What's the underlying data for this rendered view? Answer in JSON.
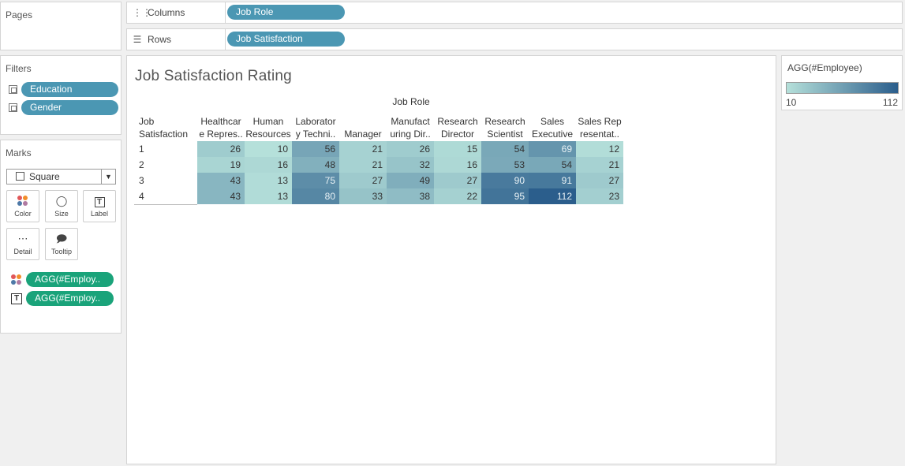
{
  "pages": {
    "title": "Pages"
  },
  "shelves": {
    "columns": {
      "label": "Columns",
      "pill": "Job Role"
    },
    "rows": {
      "label": "Rows",
      "pill": "Job Satisfaction"
    }
  },
  "filters": {
    "title": "Filters",
    "items": [
      "Education",
      "Gender"
    ]
  },
  "marks": {
    "title": "Marks",
    "type": "Square",
    "buttons": [
      "Color",
      "Size",
      "Label",
      "Detail",
      "Tooltip"
    ],
    "fields": [
      "AGG(#Employ..",
      "AGG(#Employ.."
    ]
  },
  "viz": {
    "title": "Job Satisfaction Rating",
    "column_header": "Job Role",
    "row_header": [
      "Job",
      "Satisfaction"
    ]
  },
  "legend": {
    "title": "AGG(#Employee)",
    "min": "10",
    "max": "112",
    "color_low": "#b5e0da",
    "color_high": "#2b5e8c"
  },
  "chart_data": {
    "type": "heatmap",
    "title": "Job Satisfaction Rating",
    "xlabel": "Job Role",
    "ylabel": "Job Satisfaction",
    "categories": [
      [
        "Healthcar",
        "e Repres.."
      ],
      [
        "Human",
        "Resources"
      ],
      [
        "Laborator",
        "y Techni.."
      ],
      [
        "",
        "Manager"
      ],
      [
        "Manufact",
        "uring Dir.."
      ],
      [
        "Research",
        "Director"
      ],
      [
        "Research",
        "Scientist"
      ],
      [
        "Sales",
        "Executive"
      ],
      [
        "Sales Rep",
        "resentat.."
      ]
    ],
    "rows": [
      "1",
      "2",
      "3",
      "4"
    ],
    "values": [
      [
        26,
        10,
        56,
        21,
        26,
        15,
        54,
        69,
        12
      ],
      [
        19,
        16,
        48,
        21,
        32,
        16,
        53,
        54,
        21
      ],
      [
        43,
        13,
        75,
        27,
        49,
        27,
        90,
        91,
        27
      ],
      [
        43,
        13,
        80,
        33,
        38,
        22,
        95,
        112,
        23
      ]
    ],
    "range": [
      10,
      112
    ]
  }
}
